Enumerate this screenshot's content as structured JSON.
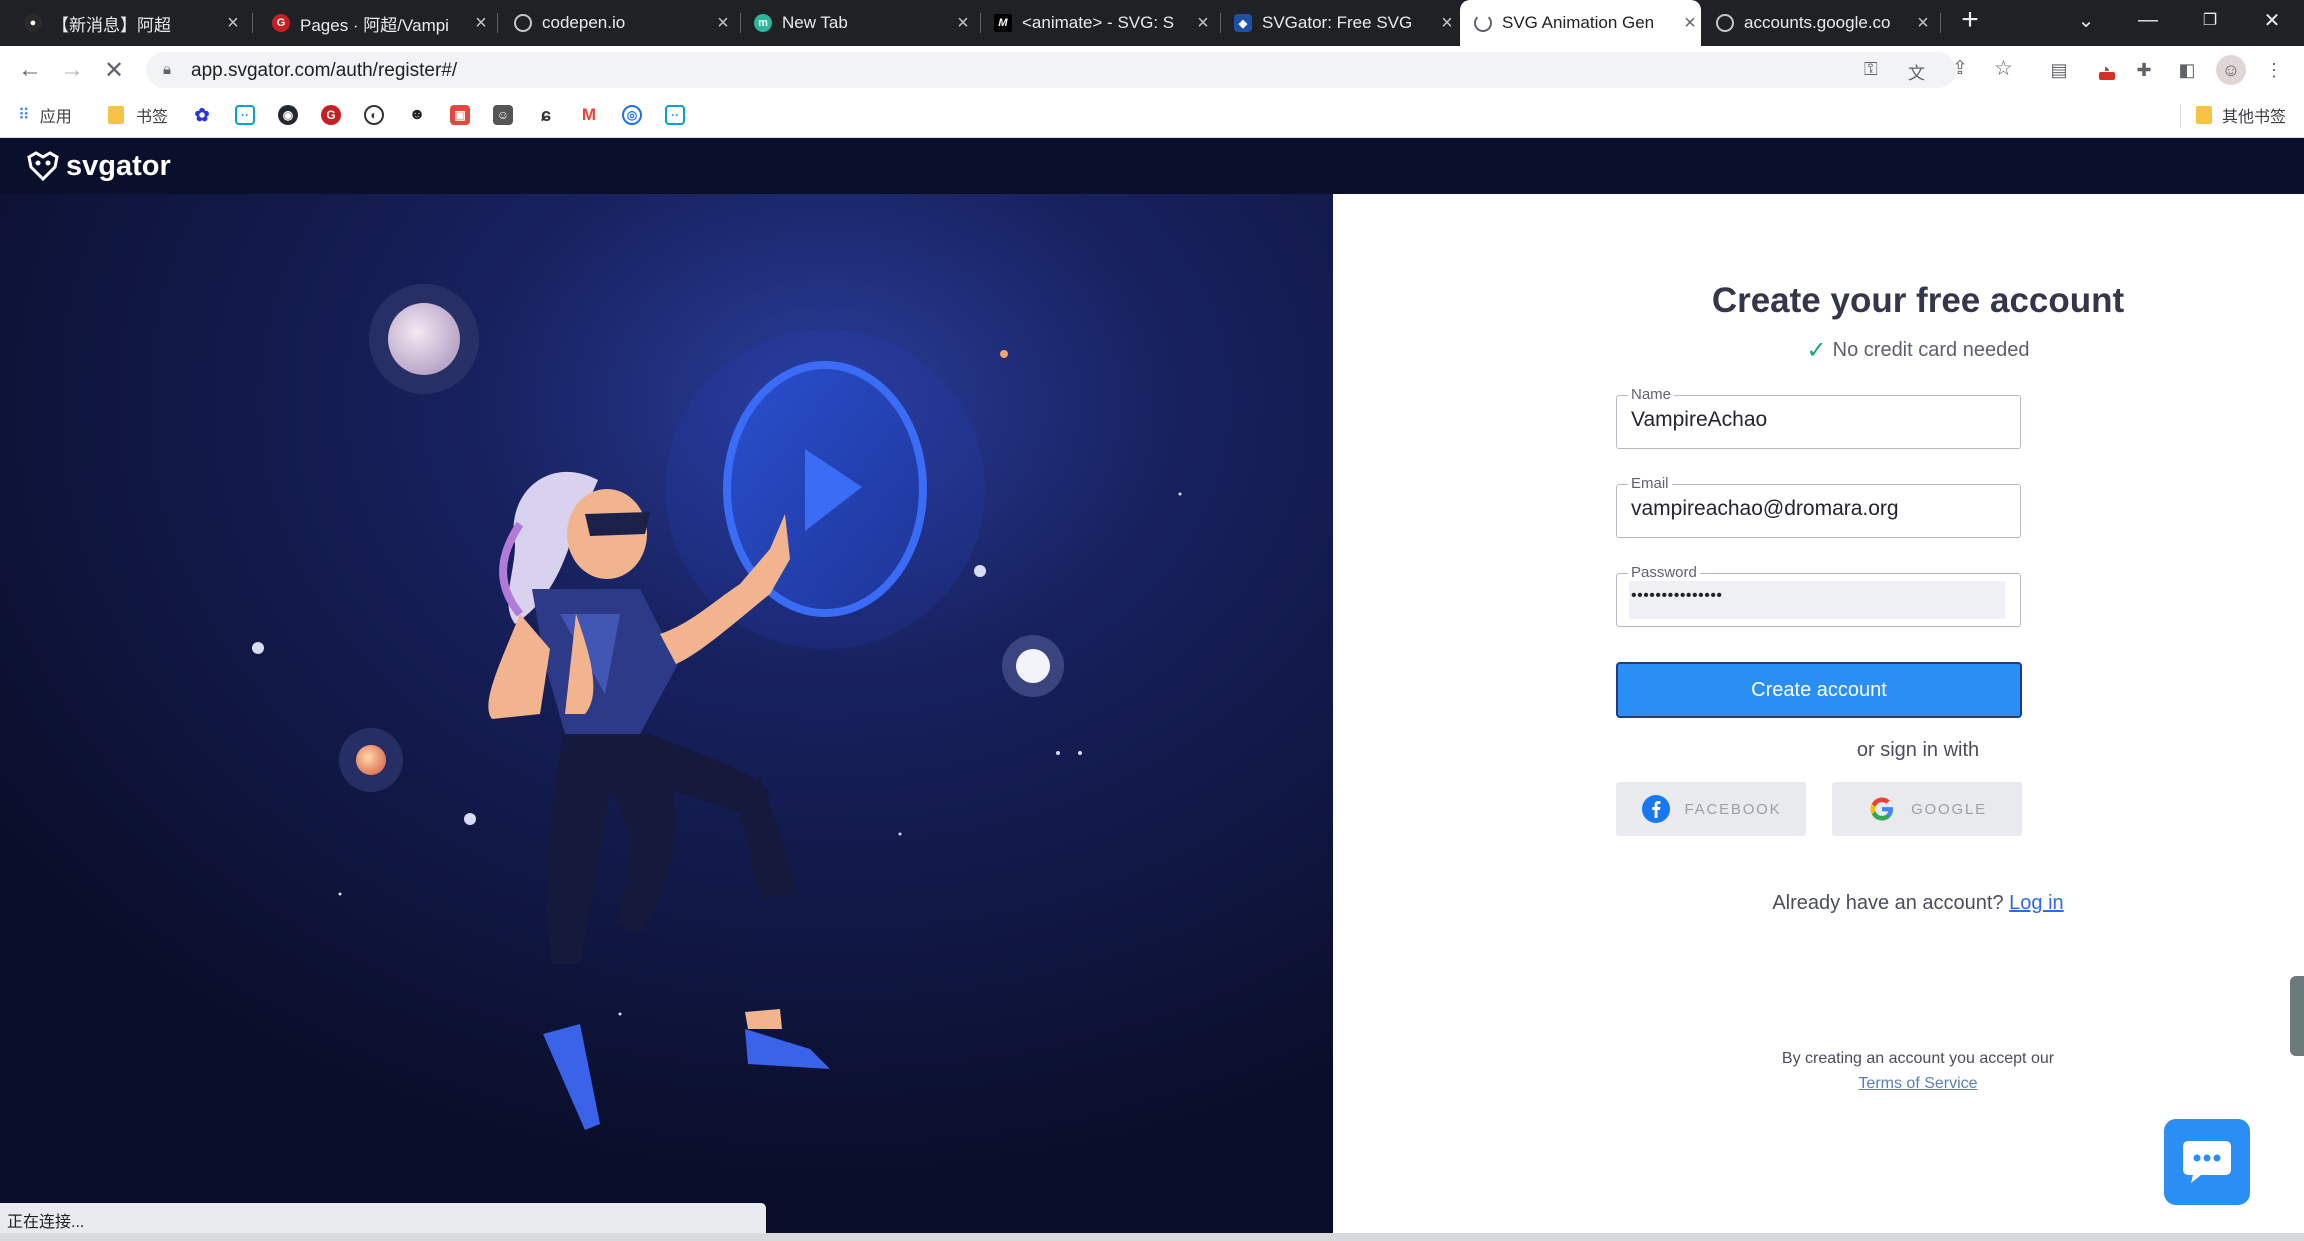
{
  "tabs": [
    {
      "title": "【新消息】阿超",
      "active": false
    },
    {
      "title": "Pages · 阿超/Vampi",
      "active": false
    },
    {
      "title": "codepen.io",
      "active": false
    },
    {
      "title": "New Tab",
      "active": false
    },
    {
      "title": "<animate> - SVG: S",
      "active": false
    },
    {
      "title": "SVGator: Free SVG",
      "active": false
    },
    {
      "title": "SVG Animation Gen",
      "active": true
    },
    {
      "title": "accounts.google.co",
      "active": false
    }
  ],
  "omnibox": {
    "url": "app.svgator.com/auth/register#/"
  },
  "bookmarks": {
    "apps": "应用",
    "folder": "书签",
    "other": "其他书签"
  },
  "brand": {
    "logo_text": "svgator",
    "accent": "#2b8ef5"
  },
  "form": {
    "title": "Create your free account",
    "subtitle": "No credit card needed",
    "name_label": "Name",
    "name_value": "VampireAchao",
    "email_label": "Email",
    "email_value": "vampireachao@dromara.org",
    "password_label": "Password",
    "password_value": "•••••••••••••••",
    "create_button": "Create account",
    "or_sign_in": "or sign in with",
    "facebook": "FACEBOOK",
    "google": "GOOGLE",
    "have_account": "Already have an account?",
    "login_link": "Log in",
    "terms_text": "By creating an account you accept our",
    "terms_link": "Terms of Service"
  },
  "status": {
    "text": "正在连接..."
  }
}
